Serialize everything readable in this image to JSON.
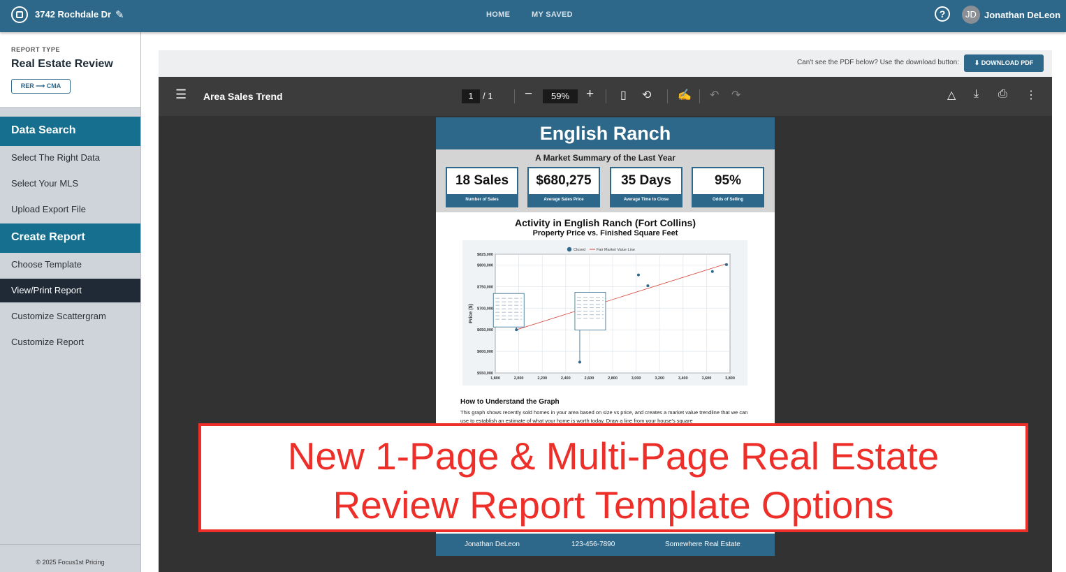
{
  "header": {
    "address": "3742 Rochdale Dr",
    "nav": [
      "HOME",
      "MY SAVED"
    ],
    "user_initials": "JD",
    "user_name": "Jonathan DeLeon",
    "help_glyph": "?"
  },
  "sidebar": {
    "report_type_label": "REPORT TYPE",
    "report_type_value": "Real Estate Review",
    "switch_button": "RER ⟶ CMA",
    "sections": [
      {
        "title": "Data Search",
        "items": [
          "Select The Right Data",
          "Select Your MLS",
          "Upload Export File"
        ]
      },
      {
        "title": "Create Report",
        "items": [
          "Choose Template",
          "View/Print Report",
          "Customize Scattergram",
          "Customize Report"
        ]
      }
    ],
    "active_item": "View/Print Report",
    "footer": "© 2025 Focus1st Pricing"
  },
  "download_bar": {
    "note": "Can't see the PDF below? Use the download button:",
    "button": "DOWNLOAD PDF"
  },
  "viewer": {
    "title": "Area Sales Trend",
    "page_current": "1",
    "page_total": "/   1",
    "zoom": "59%"
  },
  "pdf": {
    "heading": "English Ranch",
    "summary_title": "A Market Summary of the Last Year",
    "kpis": [
      {
        "value": "18 Sales",
        "label": "Number of Sales"
      },
      {
        "value": "$680,275",
        "label": "Average Sales Price"
      },
      {
        "value": "35 Days",
        "label": "Average Time to Close"
      },
      {
        "value": "95%",
        "label": "Odds of Selling"
      }
    ],
    "activity_title": "Activity in English Ranch (Fort Collins)",
    "activity_subtitle": "Property Price vs. Finished Square Feet",
    "how_title": "How to Understand the Graph",
    "how_text": "This graph shows recently sold homes in your area based on size vs price, and creates a market value trendline that we can use to establish an estimate of what your home is worth today. Draw a line from your house's square",
    "footer": {
      "name": "Jonathan DeLeon",
      "phone": "123-456-7890",
      "company": "Somewhere Real Estate"
    }
  },
  "chart_data": {
    "type": "scatter",
    "xlabel": "",
    "ylabel": "Price ($)",
    "xlim": [
      1800,
      3800
    ],
    "ylim": [
      550000,
      825000
    ],
    "x_ticks": [
      "1,800",
      "2,000",
      "2,200",
      "2,400",
      "2,600",
      "2,800",
      "3,000",
      "3,200",
      "3,400",
      "3,600",
      "3,800"
    ],
    "y_ticks": [
      "$550,000",
      "$600,000",
      "$650,000",
      "$700,000",
      "$750,000",
      "$800,000",
      "$825,000"
    ],
    "y_tick_values": [
      550000,
      600000,
      650000,
      700000,
      750000,
      800000,
      825000
    ],
    "legend": [
      "Closed",
      "Fair Market Value Line"
    ],
    "legend_position": "top",
    "colors": {
      "points": "#2d6789",
      "line": "#d9443a"
    },
    "series": [
      {
        "name": "Closed",
        "x": [
          1980,
          2520,
          3020,
          3100,
          3650,
          3770
        ],
        "y": [
          650000,
          575000,
          777000,
          752000,
          785000,
          801000
        ]
      }
    ],
    "trendline": {
      "name": "Fair Market Value Line",
      "x": [
        1980,
        3770
      ],
      "y": [
        650000,
        803000
      ]
    }
  },
  "banner": {
    "line1": "New 1-Page & Multi-Page Real Estate",
    "line2": "Review Report Template Options"
  }
}
